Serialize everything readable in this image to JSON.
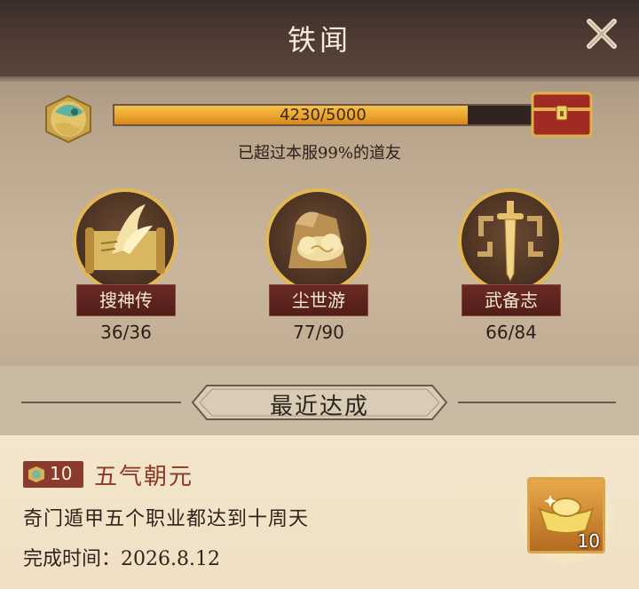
{
  "window": {
    "title": "铁闻"
  },
  "progress": {
    "text": "4230/5000",
    "current": 4230,
    "max": 5000,
    "rank_text": "已超过本服99%的道友"
  },
  "categories": [
    {
      "label": "搜神传",
      "count": "36/36",
      "icon": "scroll-crane-icon"
    },
    {
      "label": "尘世游",
      "count": "77/90",
      "icon": "rock-cloud-icon"
    },
    {
      "label": "武备志",
      "count": "66/84",
      "icon": "sword-icon"
    }
  ],
  "recent": {
    "section_title": "最近达成",
    "points": "10",
    "name": "五气朝元",
    "description": "奇门遁甲五个职业都达到十周天",
    "time_label": "完成时间：",
    "time_value": "2026.8.12",
    "reward_qty": "10"
  },
  "colors": {
    "bar_fill": "#e9a12a",
    "label_bg": "#5e2420",
    "points_bg": "#8b3a2e",
    "ach_name": "#8a3a24"
  }
}
